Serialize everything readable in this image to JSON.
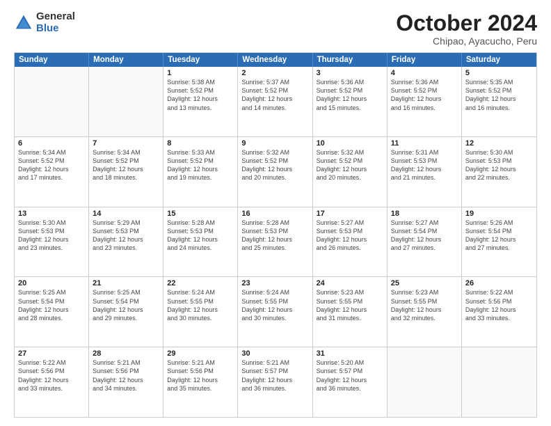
{
  "logo": {
    "general": "General",
    "blue": "Blue"
  },
  "title": "October 2024",
  "subtitle": "Chipao, Ayacucho, Peru",
  "header_days": [
    "Sunday",
    "Monday",
    "Tuesday",
    "Wednesday",
    "Thursday",
    "Friday",
    "Saturday"
  ],
  "weeks": [
    [
      {
        "day": "",
        "lines": []
      },
      {
        "day": "",
        "lines": []
      },
      {
        "day": "1",
        "lines": [
          "Sunrise: 5:38 AM",
          "Sunset: 5:52 PM",
          "Daylight: 12 hours",
          "and 13 minutes."
        ]
      },
      {
        "day": "2",
        "lines": [
          "Sunrise: 5:37 AM",
          "Sunset: 5:52 PM",
          "Daylight: 12 hours",
          "and 14 minutes."
        ]
      },
      {
        "day": "3",
        "lines": [
          "Sunrise: 5:36 AM",
          "Sunset: 5:52 PM",
          "Daylight: 12 hours",
          "and 15 minutes."
        ]
      },
      {
        "day": "4",
        "lines": [
          "Sunrise: 5:36 AM",
          "Sunset: 5:52 PM",
          "Daylight: 12 hours",
          "and 16 minutes."
        ]
      },
      {
        "day": "5",
        "lines": [
          "Sunrise: 5:35 AM",
          "Sunset: 5:52 PM",
          "Daylight: 12 hours",
          "and 16 minutes."
        ]
      }
    ],
    [
      {
        "day": "6",
        "lines": [
          "Sunrise: 5:34 AM",
          "Sunset: 5:52 PM",
          "Daylight: 12 hours",
          "and 17 minutes."
        ]
      },
      {
        "day": "7",
        "lines": [
          "Sunrise: 5:34 AM",
          "Sunset: 5:52 PM",
          "Daylight: 12 hours",
          "and 18 minutes."
        ]
      },
      {
        "day": "8",
        "lines": [
          "Sunrise: 5:33 AM",
          "Sunset: 5:52 PM",
          "Daylight: 12 hours",
          "and 19 minutes."
        ]
      },
      {
        "day": "9",
        "lines": [
          "Sunrise: 5:32 AM",
          "Sunset: 5:52 PM",
          "Daylight: 12 hours",
          "and 20 minutes."
        ]
      },
      {
        "day": "10",
        "lines": [
          "Sunrise: 5:32 AM",
          "Sunset: 5:52 PM",
          "Daylight: 12 hours",
          "and 20 minutes."
        ]
      },
      {
        "day": "11",
        "lines": [
          "Sunrise: 5:31 AM",
          "Sunset: 5:53 PM",
          "Daylight: 12 hours",
          "and 21 minutes."
        ]
      },
      {
        "day": "12",
        "lines": [
          "Sunrise: 5:30 AM",
          "Sunset: 5:53 PM",
          "Daylight: 12 hours",
          "and 22 minutes."
        ]
      }
    ],
    [
      {
        "day": "13",
        "lines": [
          "Sunrise: 5:30 AM",
          "Sunset: 5:53 PM",
          "Daylight: 12 hours",
          "and 23 minutes."
        ]
      },
      {
        "day": "14",
        "lines": [
          "Sunrise: 5:29 AM",
          "Sunset: 5:53 PM",
          "Daylight: 12 hours",
          "and 23 minutes."
        ]
      },
      {
        "day": "15",
        "lines": [
          "Sunrise: 5:28 AM",
          "Sunset: 5:53 PM",
          "Daylight: 12 hours",
          "and 24 minutes."
        ]
      },
      {
        "day": "16",
        "lines": [
          "Sunrise: 5:28 AM",
          "Sunset: 5:53 PM",
          "Daylight: 12 hours",
          "and 25 minutes."
        ]
      },
      {
        "day": "17",
        "lines": [
          "Sunrise: 5:27 AM",
          "Sunset: 5:53 PM",
          "Daylight: 12 hours",
          "and 26 minutes."
        ]
      },
      {
        "day": "18",
        "lines": [
          "Sunrise: 5:27 AM",
          "Sunset: 5:54 PM",
          "Daylight: 12 hours",
          "and 27 minutes."
        ]
      },
      {
        "day": "19",
        "lines": [
          "Sunrise: 5:26 AM",
          "Sunset: 5:54 PM",
          "Daylight: 12 hours",
          "and 27 minutes."
        ]
      }
    ],
    [
      {
        "day": "20",
        "lines": [
          "Sunrise: 5:25 AM",
          "Sunset: 5:54 PM",
          "Daylight: 12 hours",
          "and 28 minutes."
        ]
      },
      {
        "day": "21",
        "lines": [
          "Sunrise: 5:25 AM",
          "Sunset: 5:54 PM",
          "Daylight: 12 hours",
          "and 29 minutes."
        ]
      },
      {
        "day": "22",
        "lines": [
          "Sunrise: 5:24 AM",
          "Sunset: 5:55 PM",
          "Daylight: 12 hours",
          "and 30 minutes."
        ]
      },
      {
        "day": "23",
        "lines": [
          "Sunrise: 5:24 AM",
          "Sunset: 5:55 PM",
          "Daylight: 12 hours",
          "and 30 minutes."
        ]
      },
      {
        "day": "24",
        "lines": [
          "Sunrise: 5:23 AM",
          "Sunset: 5:55 PM",
          "Daylight: 12 hours",
          "and 31 minutes."
        ]
      },
      {
        "day": "25",
        "lines": [
          "Sunrise: 5:23 AM",
          "Sunset: 5:55 PM",
          "Daylight: 12 hours",
          "and 32 minutes."
        ]
      },
      {
        "day": "26",
        "lines": [
          "Sunrise: 5:22 AM",
          "Sunset: 5:56 PM",
          "Daylight: 12 hours",
          "and 33 minutes."
        ]
      }
    ],
    [
      {
        "day": "27",
        "lines": [
          "Sunrise: 5:22 AM",
          "Sunset: 5:56 PM",
          "Daylight: 12 hours",
          "and 33 minutes."
        ]
      },
      {
        "day": "28",
        "lines": [
          "Sunrise: 5:21 AM",
          "Sunset: 5:56 PM",
          "Daylight: 12 hours",
          "and 34 minutes."
        ]
      },
      {
        "day": "29",
        "lines": [
          "Sunrise: 5:21 AM",
          "Sunset: 5:56 PM",
          "Daylight: 12 hours",
          "and 35 minutes."
        ]
      },
      {
        "day": "30",
        "lines": [
          "Sunrise: 5:21 AM",
          "Sunset: 5:57 PM",
          "Daylight: 12 hours",
          "and 36 minutes."
        ]
      },
      {
        "day": "31",
        "lines": [
          "Sunrise: 5:20 AM",
          "Sunset: 5:57 PM",
          "Daylight: 12 hours",
          "and 36 minutes."
        ]
      },
      {
        "day": "",
        "lines": []
      },
      {
        "day": "",
        "lines": []
      }
    ]
  ]
}
